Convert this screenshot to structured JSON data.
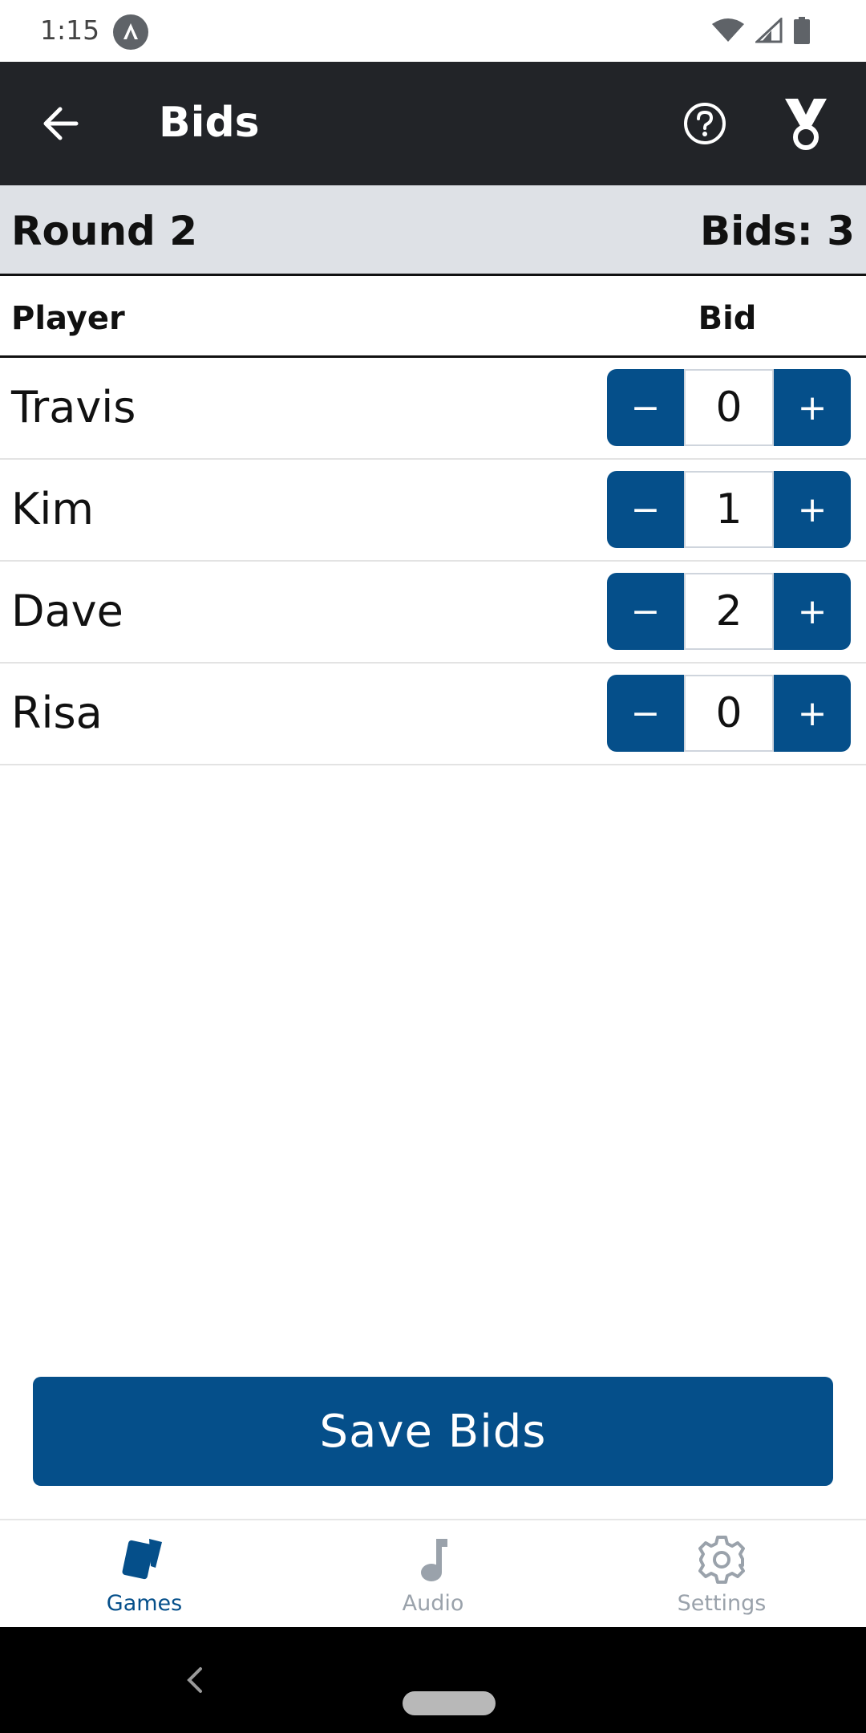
{
  "status_bar": {
    "time": "1:15",
    "icons": [
      "notification-icon",
      "wifi-icon",
      "signal-icon",
      "battery-icon"
    ]
  },
  "app_bar": {
    "title": "Bids",
    "icons": [
      "back-arrow-icon",
      "help-icon",
      "medal-icon"
    ]
  },
  "round": {
    "title": "Round 2",
    "bids_label": "Bids: 3"
  },
  "table": {
    "header_player": "Player",
    "header_bid": "Bid",
    "rows": [
      {
        "name": "Travis",
        "bid": "0"
      },
      {
        "name": "Kim",
        "bid": "1"
      },
      {
        "name": "Dave",
        "bid": "2"
      },
      {
        "name": "Risa",
        "bid": "0"
      }
    ],
    "minus_symbol": "−",
    "plus_symbol": "+"
  },
  "save_button": {
    "label": "Save Bids"
  },
  "tabs": [
    {
      "label": "Games",
      "icon": "cards-icon",
      "active": true
    },
    {
      "label": "Audio",
      "icon": "music-note-icon",
      "active": false
    },
    {
      "label": "Settings",
      "icon": "gear-icon",
      "active": false
    }
  ],
  "colors": {
    "primary": "#054f8a",
    "app_bar": "#222428",
    "round_bar": "#dee1e6",
    "inactive_tab": "#9aa2ab"
  }
}
